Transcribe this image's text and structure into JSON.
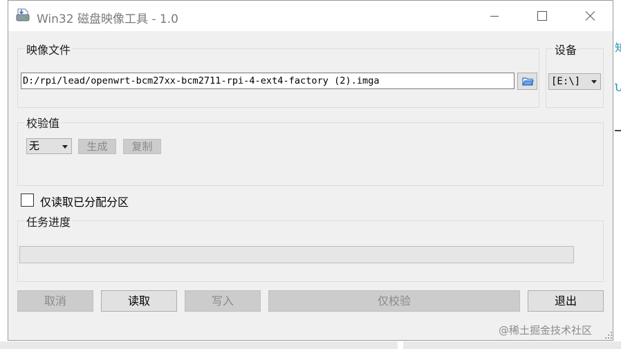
{
  "window": {
    "title": "Win32 磁盘映像工具 - 1.0",
    "icon": "disk-imager-icon",
    "controls": {
      "minimize": "minimize-icon",
      "maximize": "maximize-icon",
      "close": "close-icon"
    }
  },
  "image_file": {
    "label": "映像文件",
    "path": "D:/rpi/lead/openwrt-bcm27xx-bcm2711-rpi-4-ext4-factory (2).imga",
    "browse_icon": "folder-open-icon"
  },
  "device": {
    "label": "设备",
    "selected": "[E:\\]"
  },
  "hash": {
    "label": "校验值",
    "selected": "无",
    "generate_label": "生成",
    "copy_label": "复制"
  },
  "options": {
    "read_only_allocated_label": "仅读取已分配分区",
    "read_only_allocated_checked": false
  },
  "progress": {
    "label": "任务进度",
    "value": 0
  },
  "actions": {
    "cancel": "取消",
    "read": "读取",
    "write": "写入",
    "verify_only": "仅校验",
    "exit": "退出"
  },
  "watermark": "@稀土掘金技术社区",
  "colors": {
    "window_bg": "#f0f0f0",
    "disabled_button_bg": "#cccccc",
    "disabled_text": "#8a8a8a",
    "accent_folder": "#2a6fc9"
  }
}
